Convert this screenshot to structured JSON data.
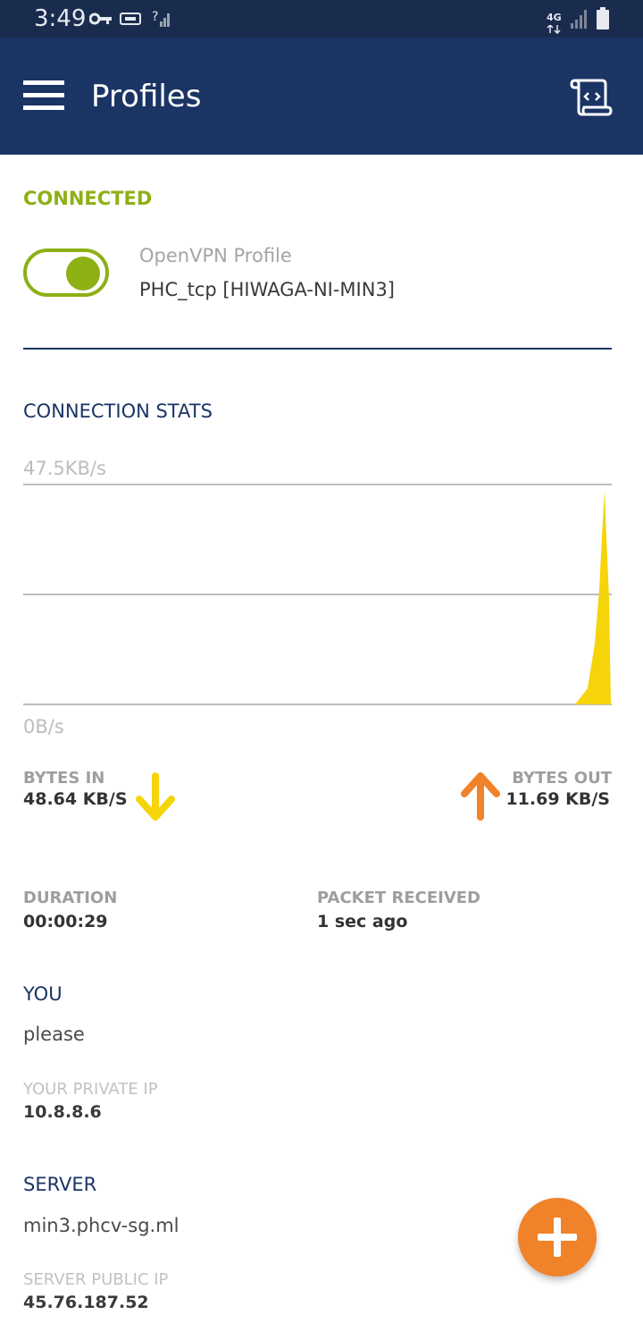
{
  "status_bar": {
    "time": "3:49",
    "icons": [
      "key-icon",
      "sim-icon",
      "wifi-unknown-signal-icon",
      "4g-data-icon",
      "cell-signal-icon",
      "battery-icon"
    ],
    "network_label": "4G"
  },
  "app_bar": {
    "title": "Profiles",
    "menu_icon": "hamburger-menu-icon",
    "action_icon": "log-scroll-icon"
  },
  "connection": {
    "state": "CONNECTED",
    "toggle_on": true,
    "profile_type": "OpenVPN Profile",
    "profile_name": "PHC_tcp [HIWAGA-NI-MIN3]"
  },
  "stats": {
    "title": "CONNECTION STATS",
    "graph_max_label": "47.5KB/s",
    "graph_min_label": "0B/s",
    "bytes_in_label": "BYTES IN",
    "bytes_in_value": "48.64 KB/S",
    "bytes_out_label": "BYTES OUT",
    "bytes_out_value": "11.69 KB/S",
    "duration_label": "DURATION",
    "duration_value": "00:00:29",
    "packet_label": "PACKET RECEIVED",
    "packet_value": "1 sec ago"
  },
  "you": {
    "title": "YOU",
    "value": "please",
    "private_ip_label": "YOUR PRIVATE IP",
    "private_ip_value": "10.8.8.6"
  },
  "server": {
    "title": "SERVER",
    "value": "min3.phcv-sg.ml",
    "public_ip_label": "SERVER PUBLIC IP",
    "public_ip_value": "45.76.187.52"
  },
  "fab": {
    "icon": "plus-icon"
  },
  "colors": {
    "accent_green": "#8db014",
    "header_blue": "#1a3464",
    "download_yellow": "#f5d40a",
    "upload_orange": "#f0822a"
  }
}
